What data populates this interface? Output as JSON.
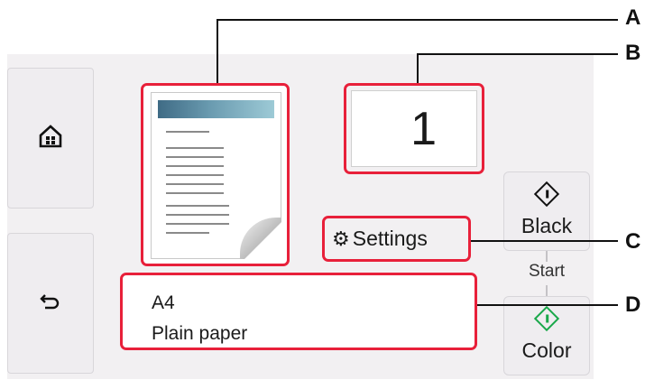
{
  "preview": {
    "name": "document-preview"
  },
  "copies": {
    "value": "1"
  },
  "settings": {
    "icon": "gear-icon",
    "label": "Settings"
  },
  "paper": {
    "size": "A4",
    "type": "Plain paper"
  },
  "start": {
    "black_label": "Black",
    "start_label": "Start",
    "color_label": "Color"
  },
  "nav": {
    "home_icon": "home-icon",
    "back_icon": "back-icon"
  },
  "callouts": {
    "a": "A",
    "b": "B",
    "c": "C",
    "d": "D"
  },
  "colors": {
    "highlight": "#e8203a",
    "color_start": "#19a84a"
  }
}
